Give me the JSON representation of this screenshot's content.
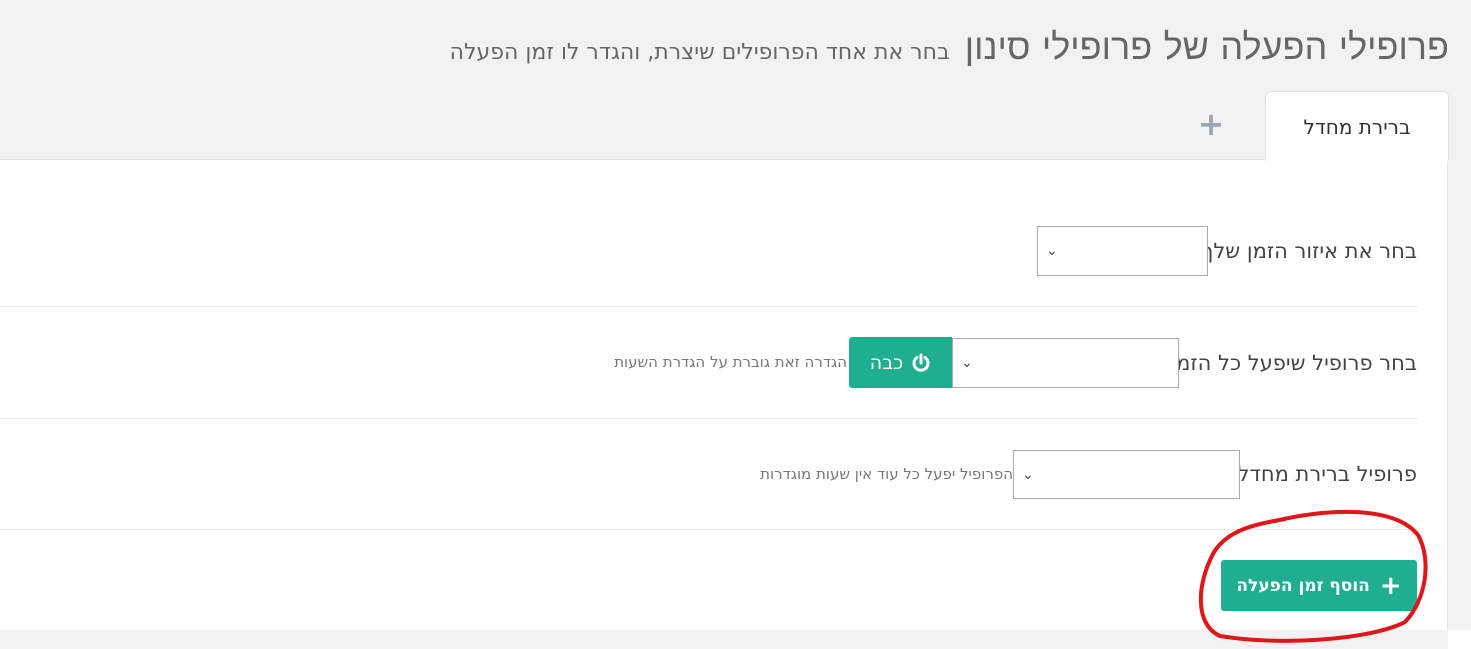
{
  "header": {
    "title": "פרופילי הפעלה של פרופילי סינון",
    "subtitle": "בחר את אחד הפרופילים שיצרת, והגדר לו זמן הפעלה"
  },
  "tabs": [
    {
      "label": "ברירת מחדל",
      "active": true
    }
  ],
  "add_tab_icon": "plus-icon",
  "rows": {
    "timezone": {
      "label": "בחר את איזור הזמן שלך",
      "selected": ""
    },
    "always_profile": {
      "label": "בחר פרופיל שיפעל כל הזמן",
      "selected": "",
      "off_button_label": "כבה",
      "off_button_icon": "power-icon",
      "hint": "הגדרה זאת גוברת על הגדרת השעות"
    },
    "default_profile": {
      "label": "פרופיל ברירת מחדל",
      "selected": "",
      "hint": "הפרופיל יפעל כל עוד אין שעות מוגדרות"
    }
  },
  "add_button": {
    "label": "הוסף זמן הפעלה",
    "icon": "plus-icon"
  },
  "colors": {
    "accent": "#1fae8f",
    "annotation": "#e0161b"
  }
}
